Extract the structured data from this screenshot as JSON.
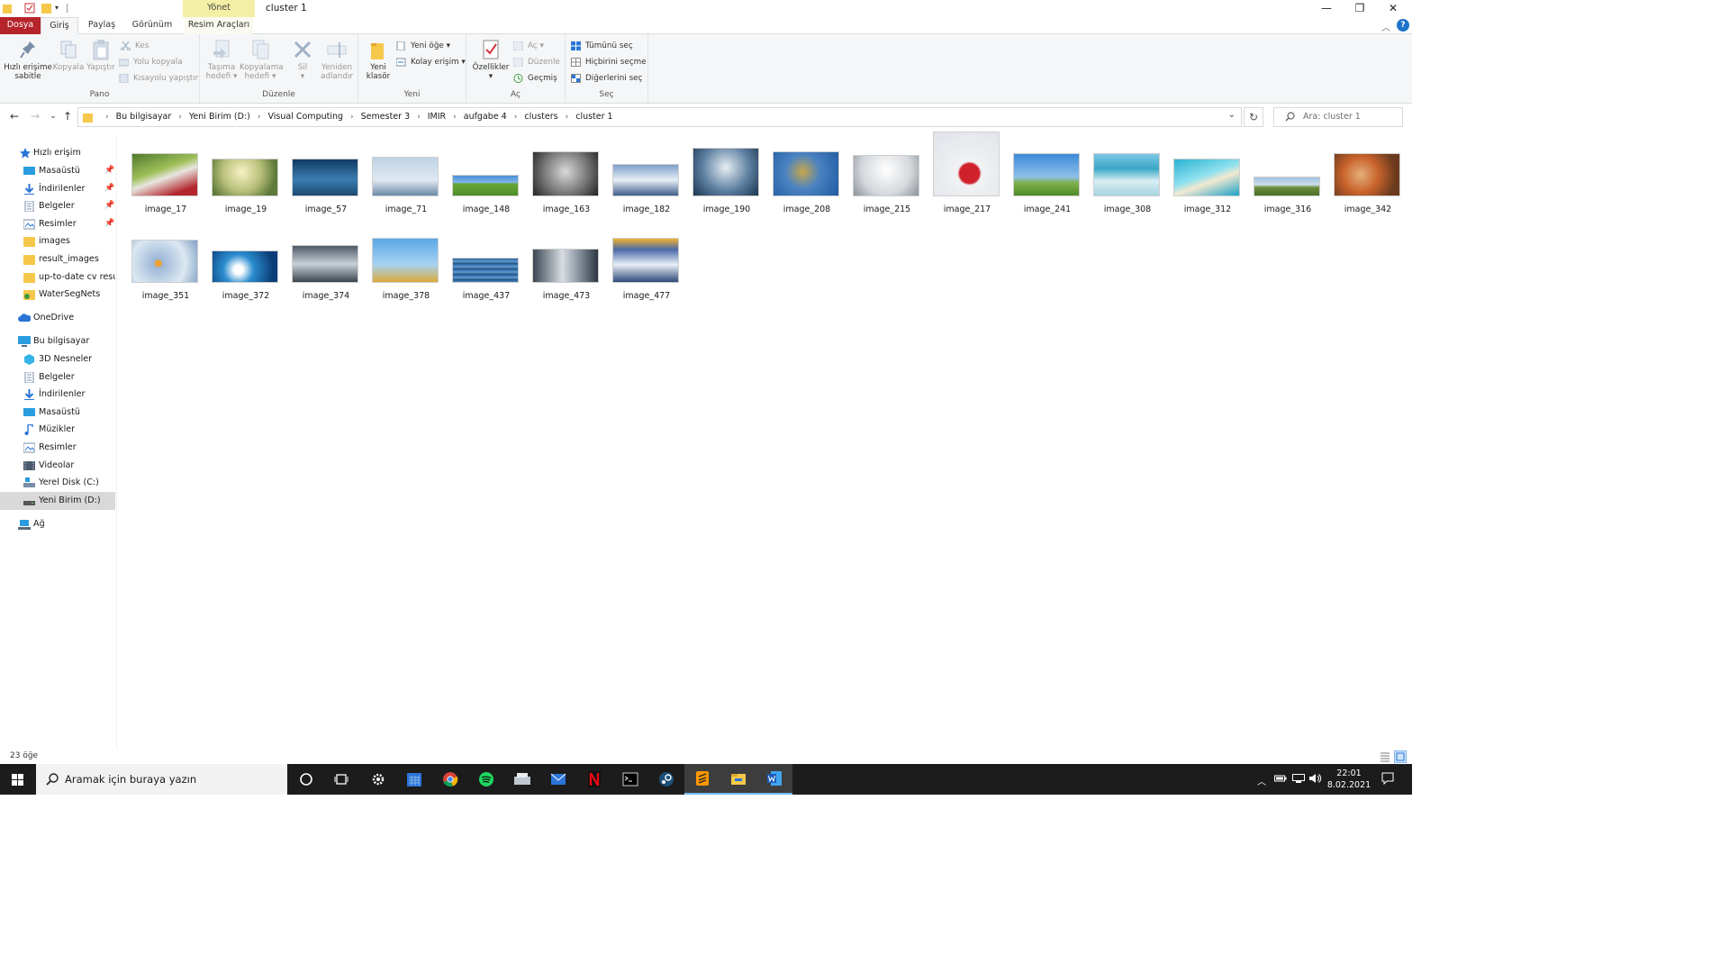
{
  "window": {
    "title": "cluster 1",
    "context_group": "Yönet",
    "controls": {
      "minimize": "—",
      "restore": "❐",
      "close": "✕"
    }
  },
  "tabs": {
    "file": "Dosya",
    "home": "Giriş",
    "share": "Paylaş",
    "view": "Görünüm",
    "picture_tools": "Resim Araçları"
  },
  "ribbon": {
    "clipboard": {
      "label": "Pano",
      "pin_quick_access": [
        "Hızlı erişime",
        "sabitle"
      ],
      "copy": "Kopyala",
      "paste": "Yapıştır",
      "cut": "Kes",
      "copy_path": "Yolu kopyala",
      "paste_shortcut": "Kısayolu yapıştır"
    },
    "organize": {
      "label": "Düzenle",
      "move_to": [
        "Taşıma",
        "hedefi"
      ],
      "copy_to": [
        "Kopyalama",
        "hedefi"
      ],
      "delete": "Sil",
      "rename": [
        "Yeniden",
        "adlandır"
      ]
    },
    "new": {
      "label": "Yeni",
      "new_folder": [
        "Yeni",
        "klasör"
      ],
      "new_item": "Yeni öğe",
      "easy_access": "Kolay erişim"
    },
    "open": {
      "label": "Aç",
      "properties": "Özellikler",
      "open": "Aç",
      "edit": "Düzenle",
      "history": "Geçmiş"
    },
    "select": {
      "label": "Seç",
      "select_all": "Tümünü seç",
      "select_none": "Hiçbirini seçme",
      "invert": "Diğerlerini seç"
    }
  },
  "address": {
    "crumbs": [
      "Bu bilgisayar",
      "Yeni Birim (D:)",
      "Visual Computing",
      "Semester 3",
      "IMIR",
      "aufgabe 4",
      "clusters",
      "cluster 1"
    ],
    "search_placeholder": "Ara: cluster 1"
  },
  "navpane": {
    "quick_access": "Hızlı erişim",
    "quick_items": [
      "Masaüstü",
      "İndirilenler",
      "Belgeler",
      "Resimler",
      "images",
      "result_images",
      "up-to-date cv resur",
      "WaterSegNets"
    ],
    "onedrive": "OneDrive",
    "this_pc": "Bu bilgisayar",
    "pc_items": [
      "3D Nesneler",
      "Belgeler",
      "İndirilenler",
      "Masaüstü",
      "Müzikler",
      "Resimler",
      "Videolar",
      "Yerel Disk (C:)",
      "Yeni Birim (D:)"
    ],
    "network": "Ağ"
  },
  "files": [
    "image_17",
    "image_19",
    "image_57",
    "image_71",
    "image_148",
    "image_163",
    "image_182",
    "image_190",
    "image_208",
    "image_215",
    "image_217",
    "image_241",
    "image_308",
    "image_312",
    "image_316",
    "image_342",
    "image_351",
    "image_372",
    "image_374",
    "image_378",
    "image_437",
    "image_473",
    "image_477"
  ],
  "status": {
    "item_count": "23 öğe"
  },
  "taskbar": {
    "search_placeholder": "Aramak için buraya yazın",
    "time": "22:01",
    "date": "8.02.2021"
  }
}
